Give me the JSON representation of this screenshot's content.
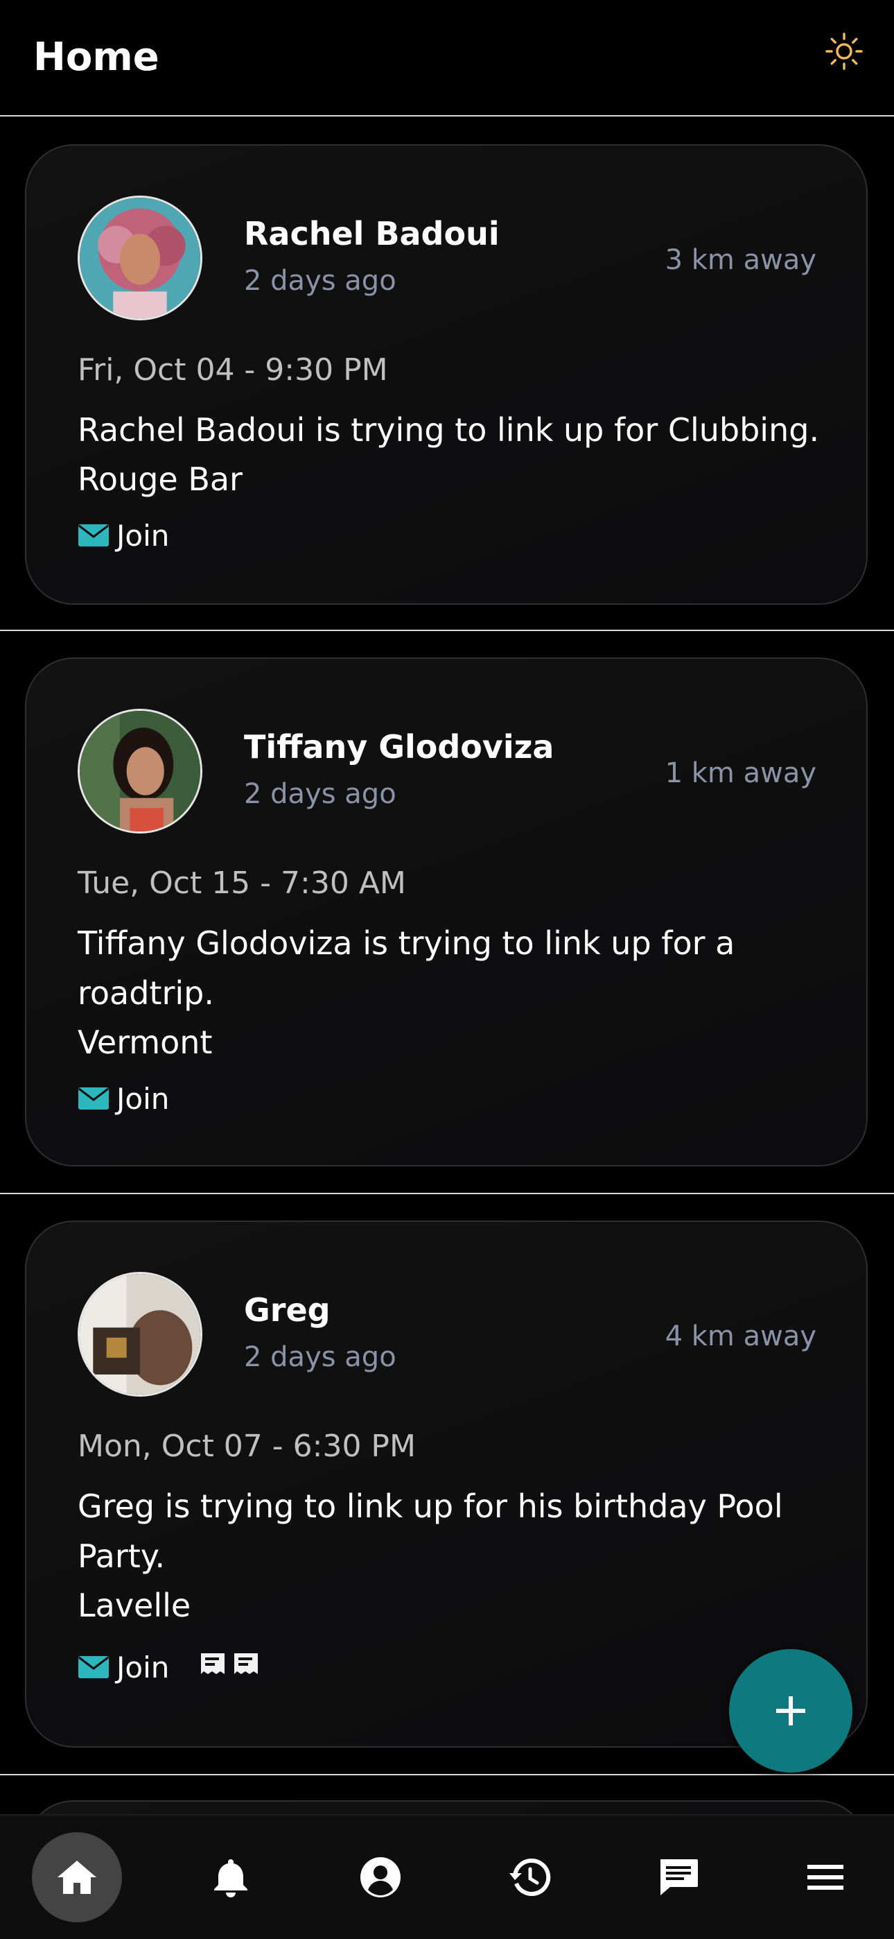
{
  "header": {
    "title": "Home",
    "theme_icon": "sun-icon"
  },
  "posts": [
    {
      "user": "Rachel Badoui",
      "posted": "2 days ago",
      "distance": "3 km away",
      "date": "Fri, Oct 04 - 9:30 PM",
      "description": "Rachel Badoui is trying to link up for Clubbing.",
      "location": "Rouge Bar",
      "join_label": "Join"
    },
    {
      "user": "Tiffany Glodoviza",
      "posted": "2 days ago",
      "distance": "1 km away",
      "date": "Tue, Oct 15 - 7:30 AM",
      "description": "Tiffany Glodoviza is trying to link up for a roadtrip.",
      "location": "Vermont",
      "join_label": "Join"
    },
    {
      "user": "Greg",
      "posted": "2 days ago",
      "distance": "4 km away",
      "date": "Mon, Oct 07 - 6:30 PM",
      "description": "Greg is trying to link up for his birthday Pool Party.",
      "location": "Lavelle",
      "join_label": "Join"
    }
  ],
  "fab": {
    "icon": "plus-icon"
  },
  "bottom_nav": [
    {
      "icon": "home-icon",
      "active": true
    },
    {
      "icon": "bell-icon",
      "active": false
    },
    {
      "icon": "profile-icon",
      "active": false
    },
    {
      "icon": "history-icon",
      "active": false
    },
    {
      "icon": "chat-icon",
      "active": false
    },
    {
      "icon": "menu-icon",
      "active": false
    }
  ],
  "colors": {
    "accent": "#0e7a80",
    "join_icon": "#2bb7bd",
    "muted_text": "#8a93a8",
    "sun_icon": "#f2b85a"
  }
}
